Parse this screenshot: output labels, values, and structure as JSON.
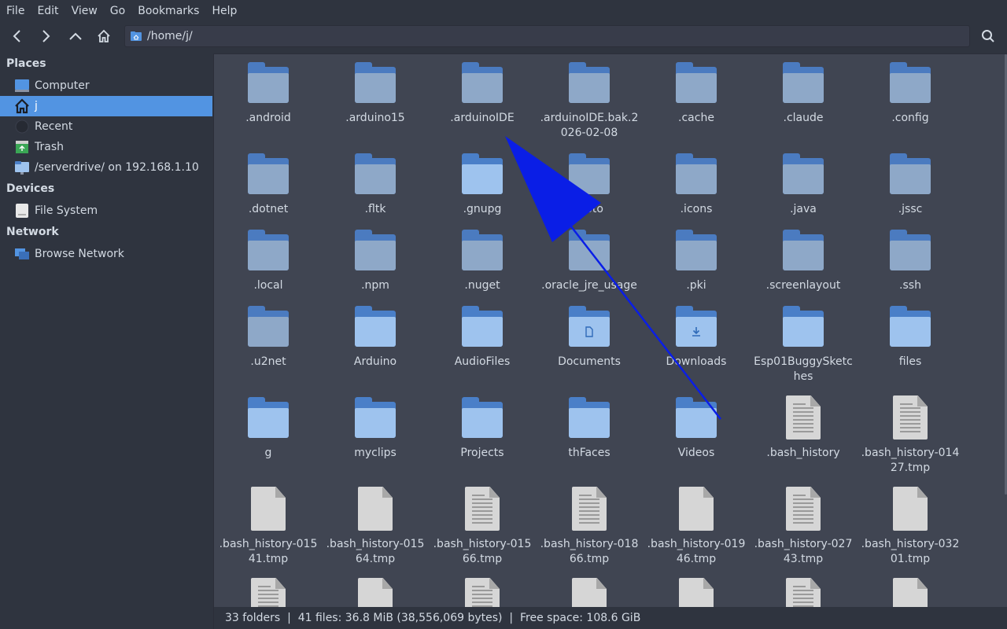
{
  "menubar": {
    "items": [
      "File",
      "Edit",
      "View",
      "Go",
      "Bookmarks",
      "Help"
    ]
  },
  "toolbar": {
    "back_icon": "chevron-left-icon",
    "forward_icon": "chevron-right-icon",
    "up_icon": "chevron-up-icon",
    "home_icon": "home-icon",
    "location_path": "/home/j/",
    "search_icon": "search-icon"
  },
  "sidebar": {
    "places_heading": "Places",
    "places": [
      {
        "label": "Computer",
        "icon": "computer-icon"
      },
      {
        "label": "j",
        "icon": "home-folder-icon",
        "selected": true
      },
      {
        "label": "Recent",
        "icon": "recent-icon"
      },
      {
        "label": "Trash",
        "icon": "trash-icon"
      },
      {
        "label": "/serverdrive/ on 192.168.1.10",
        "icon": "network-drive-icon"
      }
    ],
    "devices_heading": "Devices",
    "devices": [
      {
        "label": "File System",
        "icon": "drive-icon"
      }
    ],
    "network_heading": "Network",
    "network": [
      {
        "label": "Browse Network",
        "icon": "network-icon"
      }
    ]
  },
  "files": [
    {
      "name": ".android",
      "kind": "folder",
      "hidden": true
    },
    {
      "name": ".arduino15",
      "kind": "folder",
      "hidden": true
    },
    {
      "name": ".arduinoIDE",
      "kind": "folder",
      "hidden": true
    },
    {
      "name": ".arduinoIDE.bak.2026-02-08",
      "kind": "folder",
      "hidden": true
    },
    {
      "name": ".cache",
      "kind": "folder",
      "hidden": true
    },
    {
      "name": ".claude",
      "kind": "folder",
      "hidden": true
    },
    {
      "name": ".config",
      "kind": "folder",
      "hidden": true
    },
    {
      "name": ".dotnet",
      "kind": "folder",
      "hidden": true
    },
    {
      "name": ".fltk",
      "kind": "folder",
      "hidden": true
    },
    {
      "name": ".gnupg",
      "kind": "folder",
      "hidden": false
    },
    {
      "name": ".hoto",
      "kind": "folder",
      "hidden": true
    },
    {
      "name": ".icons",
      "kind": "folder",
      "hidden": true
    },
    {
      "name": ".java",
      "kind": "folder",
      "hidden": true
    },
    {
      "name": ".jssc",
      "kind": "folder",
      "hidden": true
    },
    {
      "name": ".local",
      "kind": "folder",
      "hidden": true
    },
    {
      "name": ".npm",
      "kind": "folder",
      "hidden": true
    },
    {
      "name": ".nuget",
      "kind": "folder",
      "hidden": true
    },
    {
      "name": ".oracle_jre_usage",
      "kind": "folder",
      "hidden": true
    },
    {
      "name": ".pki",
      "kind": "folder",
      "hidden": true
    },
    {
      "name": ".screenlayout",
      "kind": "folder",
      "hidden": true
    },
    {
      "name": ".ssh",
      "kind": "folder",
      "hidden": true
    },
    {
      "name": ".u2net",
      "kind": "folder",
      "hidden": true
    },
    {
      "name": "Arduino",
      "kind": "folder",
      "hidden": false
    },
    {
      "name": "AudioFiles",
      "kind": "folder",
      "hidden": false
    },
    {
      "name": "Documents",
      "kind": "folder",
      "hidden": false,
      "emblem": "document-icon"
    },
    {
      "name": "Downloads",
      "kind": "folder",
      "hidden": false,
      "emblem": "download-icon"
    },
    {
      "name": "Esp01BuggySketches",
      "kind": "folder",
      "hidden": false
    },
    {
      "name": "files",
      "kind": "folder",
      "hidden": false
    },
    {
      "name": "g",
      "kind": "folder",
      "hidden": false
    },
    {
      "name": "myclips",
      "kind": "folder",
      "hidden": false
    },
    {
      "name": "Projects",
      "kind": "folder",
      "hidden": false
    },
    {
      "name": "thFaces",
      "kind": "folder",
      "hidden": false
    },
    {
      "name": "Videos",
      "kind": "folder",
      "hidden": false
    },
    {
      "name": ".bash_history",
      "kind": "file",
      "lines": true
    },
    {
      "name": ".bash_history-01427.tmp",
      "kind": "file",
      "lines": true
    },
    {
      "name": ".bash_history-01541.tmp",
      "kind": "file",
      "lines": false
    },
    {
      "name": ".bash_history-01564.tmp",
      "kind": "file",
      "lines": false
    },
    {
      "name": ".bash_history-01566.tmp",
      "kind": "file",
      "lines": true
    },
    {
      "name": ".bash_history-01866.tmp",
      "kind": "file",
      "lines": true
    },
    {
      "name": ".bash_history-01946.tmp",
      "kind": "file",
      "lines": false
    },
    {
      "name": ".bash_history-02743.tmp",
      "kind": "file",
      "lines": true
    },
    {
      "name": ".bash_history-03201.tmp",
      "kind": "file",
      "lines": false
    },
    {
      "name": "",
      "kind": "file",
      "lines": true
    },
    {
      "name": "",
      "kind": "file",
      "lines": false
    },
    {
      "name": "",
      "kind": "file",
      "lines": true
    },
    {
      "name": "",
      "kind": "file",
      "lines": false
    },
    {
      "name": "",
      "kind": "file",
      "lines": false
    },
    {
      "name": "",
      "kind": "file",
      "lines": true
    },
    {
      "name": "",
      "kind": "file",
      "lines": false
    }
  ],
  "statusbar": {
    "text": "33 folders  |  41 files: 36.8 MiB (38,556,069 bytes)  |  Free space: 108.6 GiB"
  },
  "colors": {
    "accent": "#5294e2",
    "annotation_arrow": "#0a1ee6"
  }
}
